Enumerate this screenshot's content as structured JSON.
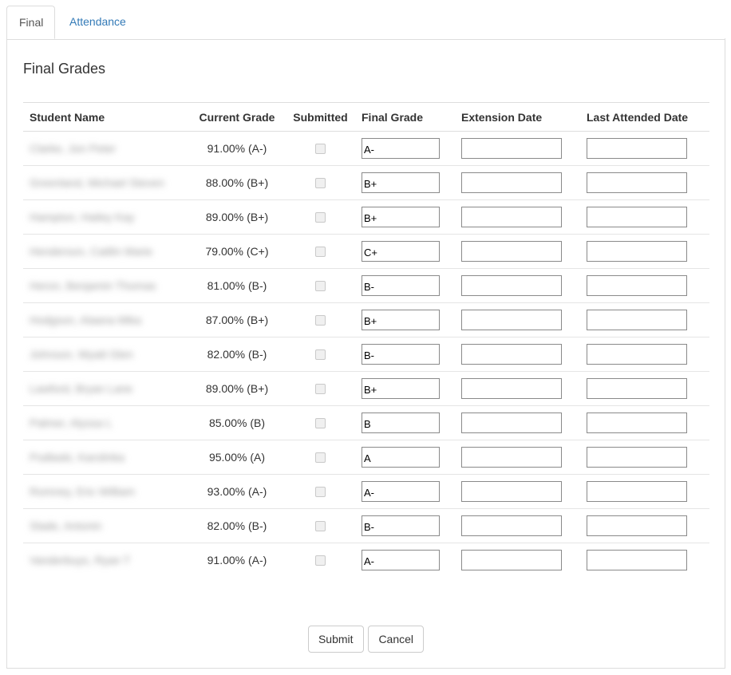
{
  "tabs": [
    {
      "label": "Final",
      "active": true
    },
    {
      "label": "Attendance",
      "active": false
    }
  ],
  "panel": {
    "title": "Final Grades"
  },
  "table": {
    "headers": {
      "name": "Student Name",
      "current": "Current Grade",
      "submitted": "Submitted",
      "final": "Final Grade",
      "extension": "Extension Date",
      "last": "Last Attended Date"
    },
    "rows": [
      {
        "name": "Clarke, Jon Peter",
        "current": "91.00% (A-)",
        "final": "A-"
      },
      {
        "name": "Greenland, Michael Steven",
        "current": "88.00% (B+)",
        "final": "B+"
      },
      {
        "name": "Hampton, Hailey Kay",
        "current": "89.00% (B+)",
        "final": "B+"
      },
      {
        "name": "Henderson, Caitlin Marie",
        "current": "79.00% (C+)",
        "final": "C+"
      },
      {
        "name": "Heron, Benjamin Thomas",
        "current": "81.00% (B-)",
        "final": "B-"
      },
      {
        "name": "Hodgson, Alaana Mika",
        "current": "87.00% (B+)",
        "final": "B+"
      },
      {
        "name": "Johnson, Wyatt Glen",
        "current": "82.00% (B-)",
        "final": "B-"
      },
      {
        "name": "Lawford, Bryan Lane",
        "current": "89.00% (B+)",
        "final": "B+"
      },
      {
        "name": "Palmer, Alyssa L",
        "current": "85.00% (B)",
        "final": "B"
      },
      {
        "name": "Podlaski, Karolinka",
        "current": "95.00% (A)",
        "final": "A"
      },
      {
        "name": "Romney, Eric William",
        "current": "93.00% (A-)",
        "final": "A-"
      },
      {
        "name": "Slade, Antonin",
        "current": "82.00% (B-)",
        "final": "B-"
      },
      {
        "name": "Vanderbuys, Ryan T",
        "current": "91.00% (A-)",
        "final": "A-"
      }
    ]
  },
  "actions": {
    "submit": "Submit",
    "cancel": "Cancel"
  }
}
